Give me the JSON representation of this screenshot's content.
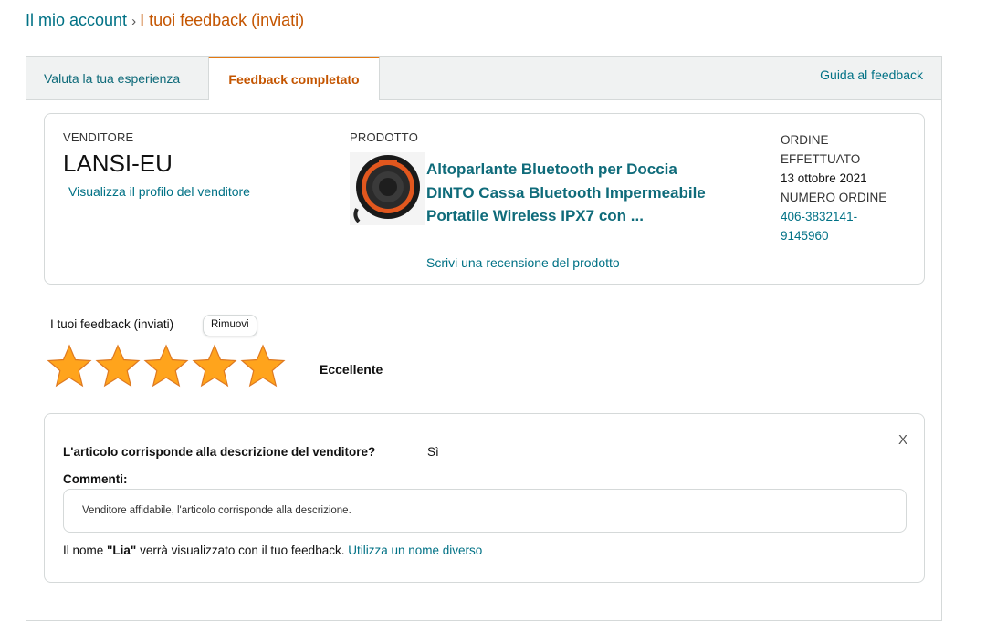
{
  "breadcrumb": {
    "parent": "Il mio account",
    "separator": "›",
    "current": "I tuoi feedback (inviati)"
  },
  "tabs": {
    "rate": "Valuta la tua esperienza",
    "completed": "Feedback completato",
    "guide": "Guida al feedback"
  },
  "order_card": {
    "seller_label": "VENDITORE",
    "seller_name": "LANSI-EU",
    "seller_profile_link": "Visualizza il profilo del venditore",
    "product_label": "PRODOTTO",
    "product_title": "Altoparlante Bluetooth per Doccia DINTO Cassa Bluetooth Impermeabile Portatile Wireless IPX7 con ...",
    "product_image_icon": "speaker-product-image",
    "review_link": "Scrivi una recensione del prodotto",
    "order_placed_label_1": "ORDINE",
    "order_placed_label_2": "EFFETTUATO",
    "order_date": "13 ottobre 2021",
    "order_number_label": "NUMERO ORDINE",
    "order_number_1": "406-3832141-",
    "order_number_2": "9145960"
  },
  "feedback": {
    "label": "I tuoi feedback (inviati)",
    "remove_button": "Rimuovi",
    "rating": 5,
    "rating_max": 5,
    "rating_text": "Eccellente"
  },
  "detail": {
    "question": "L'articolo corrisponde alla descrizione del venditore?",
    "answer": "Sì",
    "close_label": "X",
    "comments_label": "Commenti:",
    "comment": "Venditore affidabile, l'articolo corrisponde alla descrizione.",
    "name_prefix": "Il nome ",
    "name_value": "\"Lia\"",
    "name_suffix": " verrà visualizzato con il tuo feedback. ",
    "name_link": "Utilizza un nome diverso"
  },
  "colors": {
    "link": "#007185",
    "active": "#c45500",
    "star": "#ffa41c"
  }
}
